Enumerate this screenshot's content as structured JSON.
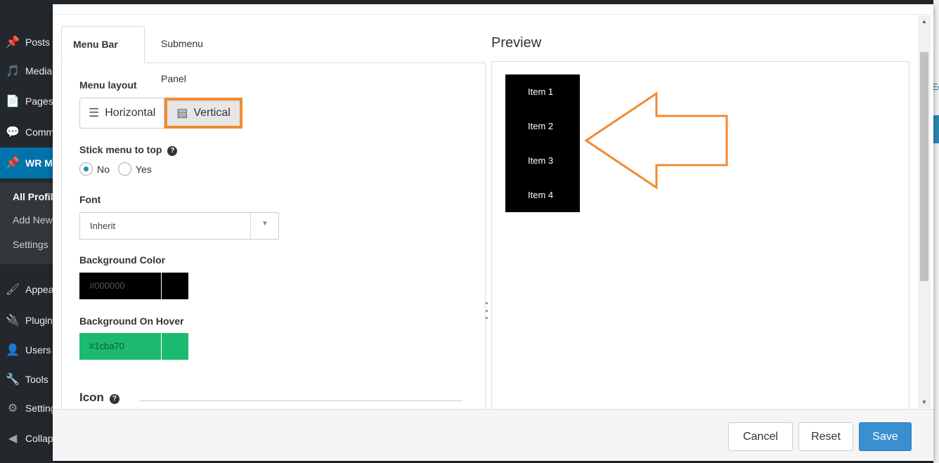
{
  "wp_menu": [
    {
      "label": "Posts",
      "icon": "pin-icon",
      "glyph": "📌",
      "active": false
    },
    {
      "label": "Media",
      "icon": "media-icon",
      "glyph": "🎵",
      "active": false
    },
    {
      "label": "Pages",
      "icon": "pages-icon",
      "glyph": "📄",
      "active": false
    },
    {
      "label": "Comments",
      "icon": "comments-icon",
      "glyph": "💬",
      "active": false
    },
    {
      "label": "WR Mega Menu",
      "icon": "pin-icon",
      "glyph": "📌",
      "active": true
    },
    {
      "label": "Appearance",
      "icon": "appearance-icon",
      "glyph": "🖌",
      "active": false
    },
    {
      "label": "Plugins",
      "icon": "plugins-icon",
      "glyph": "🔌",
      "active": false
    },
    {
      "label": "Users",
      "icon": "users-icon",
      "glyph": "👤",
      "active": false
    },
    {
      "label": "Tools",
      "icon": "tools-icon",
      "glyph": "🔧",
      "active": false
    },
    {
      "label": "Settings",
      "icon": "settings-icon",
      "glyph": "⚙",
      "active": false
    },
    {
      "label": "Collapse menu",
      "icon": "collapse-icon",
      "glyph": "◀",
      "active": false
    }
  ],
  "wp_submenu": [
    "All Profiles",
    "Add New",
    "Settings"
  ],
  "right_link": "Ed",
  "tabs": [
    "Menu Bar",
    "Submenu Panel"
  ],
  "menu_layout": {
    "label": "Menu layout",
    "options": [
      {
        "label": "Horizontal",
        "icon": "horizontal-layout-icon",
        "glyph": "☰"
      },
      {
        "label": "Vertical",
        "icon": "vertical-layout-icon",
        "glyph": "▤"
      }
    ],
    "selected": "Vertical"
  },
  "stick_to_top": {
    "label": "Stick menu to top",
    "options": [
      "No",
      "Yes"
    ],
    "selected": "No"
  },
  "font": {
    "label": "Font",
    "value": "Inherit"
  },
  "background_color": {
    "label": "Background Color",
    "value": "#000000",
    "swatch": "#000000",
    "text_color": "#555555"
  },
  "background_hover": {
    "label": "Background On Hover",
    "value": "#1cba70",
    "swatch": "#1cba70",
    "text_color": "#0b5c36"
  },
  "icon_section": {
    "label": "Icon"
  },
  "preview": {
    "title": "Preview",
    "items": [
      "Item 1",
      "Item 2",
      "Item 3",
      "Item 4"
    ]
  },
  "buttons": {
    "cancel": "Cancel",
    "reset": "Reset",
    "save": "Save"
  },
  "colors": {
    "accent": "#f28a30",
    "primary": "#3a8fd0",
    "wp_active": "#0073aa"
  }
}
